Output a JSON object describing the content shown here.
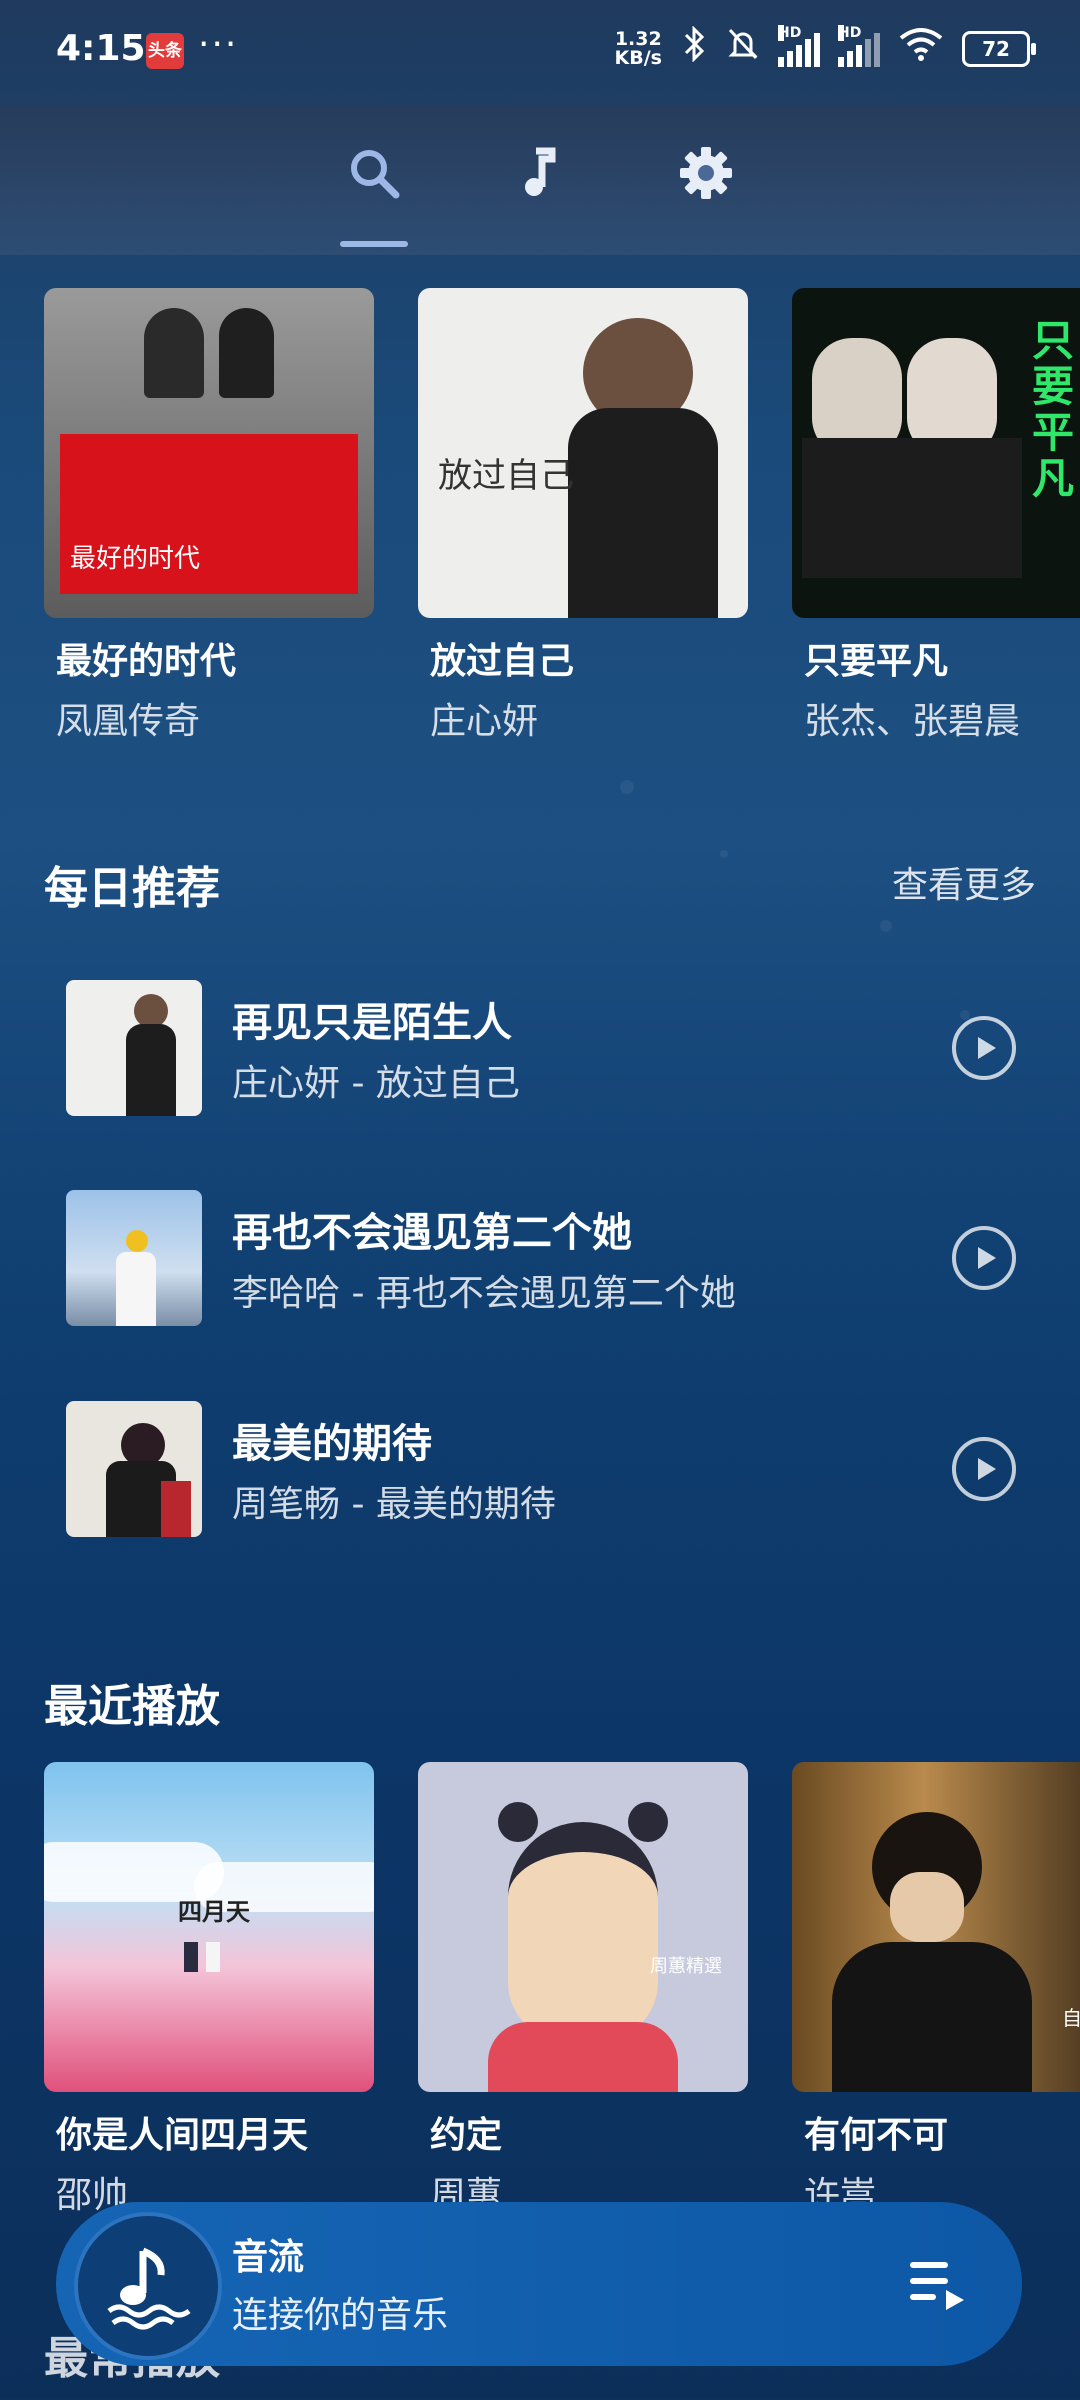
{
  "status_bar": {
    "time": "4:15",
    "badge": "头条",
    "dots": "···",
    "speed_value": "1.32",
    "speed_unit": "KB/s",
    "hd1": "HD",
    "hd2": "HD",
    "battery": "72"
  },
  "tabs": [
    {
      "icon": "search-icon",
      "active": true
    },
    {
      "icon": "music-note-icon",
      "active": false
    },
    {
      "icon": "gear-icon",
      "active": false
    }
  ],
  "featured_albums": [
    {
      "title": "最好的时代",
      "artist": "凤凰传奇",
      "cover_text": "最好的时代"
    },
    {
      "title": "放过自己",
      "artist": "庄心妍",
      "cover_text": "放过自己"
    },
    {
      "title": "只要平凡",
      "artist": "张杰、张碧晨",
      "cover_text": "只要平凡"
    }
  ],
  "daily": {
    "title": "每日推荐",
    "see_more": "查看更多",
    "songs": [
      {
        "title": "再见只是陌生人",
        "subtitle": "庄心妍 - 放过自己"
      },
      {
        "title": "再也不会遇见第二个她",
        "subtitle": "李哈哈 - 再也不会遇见第二个她"
      },
      {
        "title": "最美的期待",
        "subtitle": "周笔畅 - 最美的期待"
      }
    ]
  },
  "recent": {
    "title": "最近播放",
    "albums": [
      {
        "title": "你是人间四月天",
        "artist": "邵帅",
        "cover_text": "四月天"
      },
      {
        "title": "约定",
        "artist": "周蕙",
        "cover_text": "周蕙精選"
      },
      {
        "title": "有何不可",
        "artist": "许嵩",
        "cover_text": "自"
      }
    ]
  },
  "bottom_peek": "最常播放",
  "mini_player": {
    "title": "音流",
    "subtitle": "连接你的音乐"
  },
  "colors": {
    "accent": "#9db8e6",
    "player_bg": "#1565b4"
  }
}
